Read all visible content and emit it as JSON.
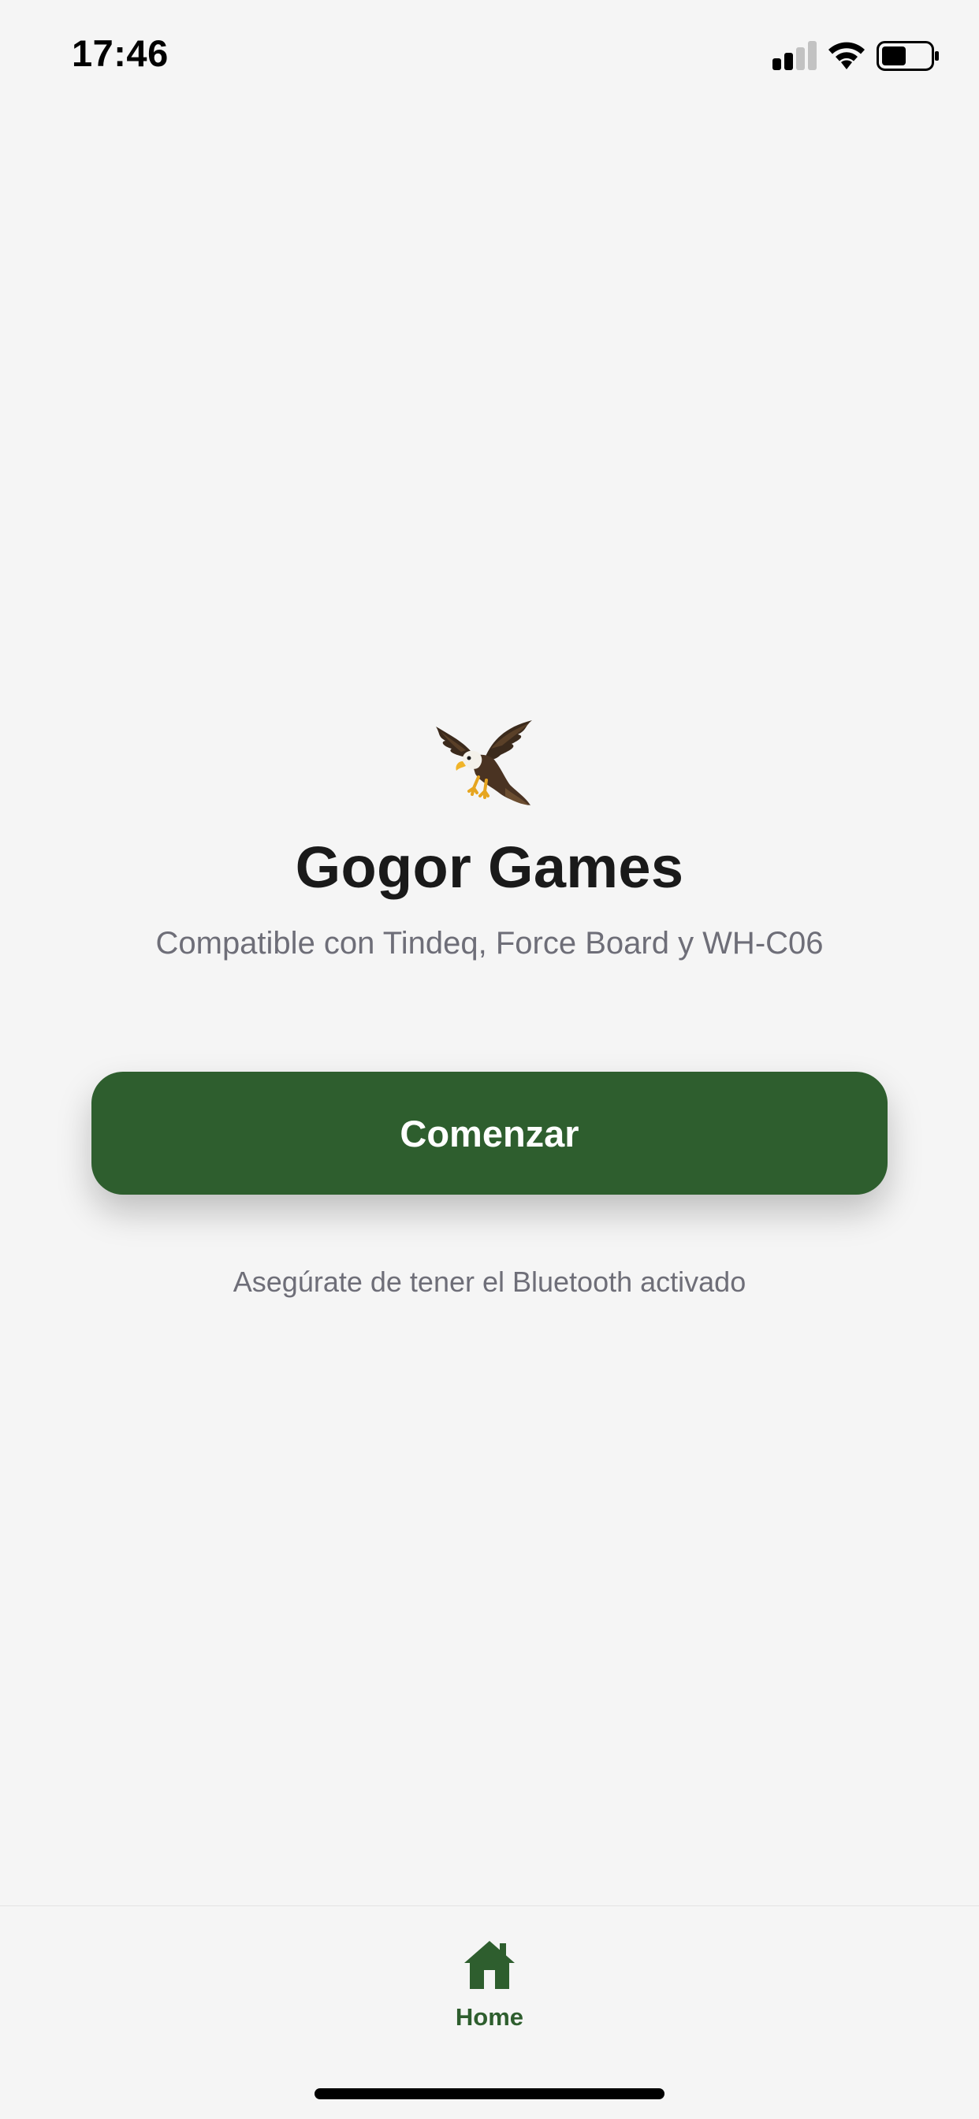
{
  "status_bar": {
    "time": "17:46",
    "icons": [
      "signal-icon",
      "wifi-icon",
      "battery-icon"
    ]
  },
  "main": {
    "logo_icon": "eagle-icon",
    "title": "Gogor Games",
    "subtitle": "Compatible con Tindeq, Force Board y WH-C06",
    "start_button_label": "Comenzar",
    "hint": "Asegúrate de tener el Bluetooth activado"
  },
  "tab_bar": {
    "items": [
      {
        "label": "Home",
        "icon": "home-icon",
        "active": true
      }
    ]
  },
  "colors": {
    "background": "#f5f5f5",
    "accent": "#2e5e2e",
    "text_primary": "#1a1a1a",
    "text_secondary": "#6e6e78"
  }
}
